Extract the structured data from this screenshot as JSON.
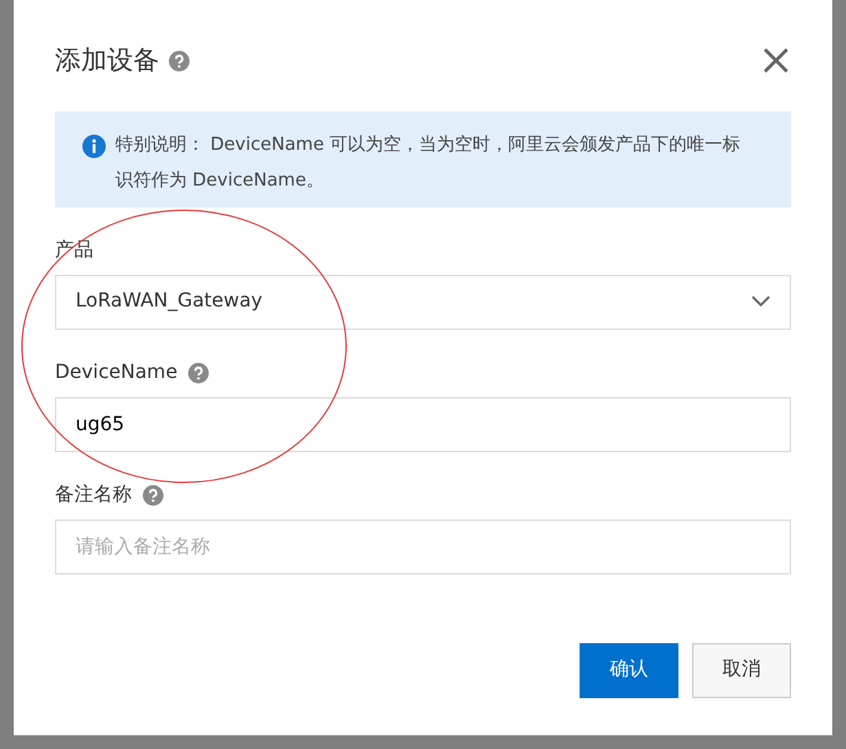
{
  "dialog": {
    "title": "添加设备",
    "title_help": true,
    "notice": {
      "label": "特别说明：",
      "text": "DeviceName 可以为空，当为空时，阿里云会颁发产品下的唯一标识符作为 DeviceName。"
    },
    "fields": [
      {
        "kind": "select",
        "label": "产品",
        "help": false,
        "value": "LoRaWAN_Gateway"
      },
      {
        "kind": "input",
        "label": "DeviceName",
        "help": true,
        "value": "ug65"
      },
      {
        "kind": "input",
        "label": "备注名称",
        "help": true,
        "placeholder": "请输入备注名称"
      }
    ],
    "buttons": [
      {
        "label": "确认",
        "kind": "primary"
      },
      {
        "label": "取消",
        "kind": "secondary"
      }
    ]
  },
  "annotation": {
    "kind": "ellipse"
  }
}
